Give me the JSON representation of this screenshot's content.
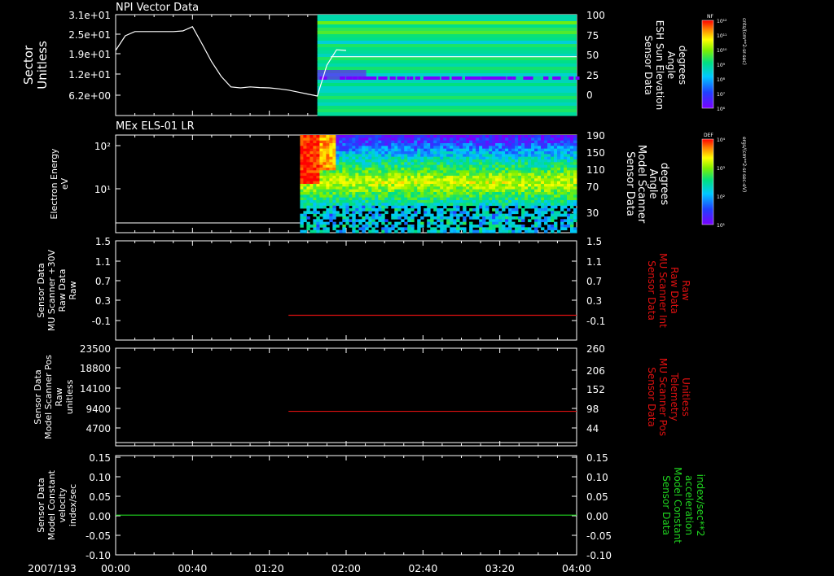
{
  "date_label": "2007/193",
  "time_ticks": [
    "00:00",
    "00:40",
    "01:20",
    "02:00",
    "02:40",
    "03:20",
    "04:00"
  ],
  "colors": {
    "white": "#ffffff",
    "red": "#e01010",
    "green": "#1fd41f",
    "background": "#000000"
  },
  "colorbars": [
    {
      "title": "NF",
      "unit": "cnts/(cm**2-sr-sec)",
      "ticks": [
        "10¹²",
        "10¹¹",
        "10¹⁰",
        "10⁹",
        "10⁸",
        "10⁷",
        "10⁶"
      ]
    },
    {
      "title": "DEF",
      "unit": "ergs/(cm**2-sr-sec-eV)",
      "ticks": [
        "10⁴",
        "10³",
        "10²",
        "10¹"
      ]
    }
  ],
  "chart_data": [
    {
      "type": "line",
      "title": "NPI Vector Data",
      "ylabel": [
        "Sector",
        "Unitless"
      ],
      "y_ticks": [
        "3.1e+01",
        "2.5e+01",
        "1.9e+01",
        "1.2e+01",
        "6.2e+00"
      ],
      "ylim": [
        0,
        31
      ],
      "right_ylabel": [
        "Sensor Data",
        "ESH Sun Elevation",
        "Angle",
        "degrees"
      ],
      "right_ticks": [
        "100",
        "75",
        "50",
        "25",
        "0"
      ],
      "right_ylim": [
        -20,
        100
      ],
      "spectrogram_start": "01:45",
      "horizontal_line_value": 50,
      "series": [
        {
          "x": [
            "00:00",
            "00:05",
            "00:10",
            "00:15",
            "00:20",
            "00:25",
            "00:30",
            "00:35",
            "00:40",
            "00:45",
            "00:50",
            "00:55",
            "01:00",
            "01:05",
            "01:10",
            "01:15",
            "01:20",
            "01:25",
            "01:30",
            "01:35",
            "01:40",
            "01:45",
            "01:50",
            "01:55",
            "02:00"
          ],
          "values": [
            20,
            24.5,
            25.8,
            25.8,
            25.8,
            25.8,
            25.8,
            26,
            27.3,
            22,
            16.5,
            12,
            8.8,
            8.5,
            8.8,
            8.6,
            8.5,
            8.2,
            7.8,
            7.2,
            6.6,
            6,
            15.5,
            20.2,
            20
          ]
        }
      ]
    },
    {
      "type": "heatmap",
      "title": "MEx ELS-01 LR",
      "ylabel": [
        "Electron Energy",
        "eV"
      ],
      "y_ticks": [
        "10²",
        "10¹"
      ],
      "yscale": "log",
      "right_ylabel": [
        "Sensor Data",
        "Model Scanner",
        "Angle",
        "degrees"
      ],
      "right_ticks": [
        "190",
        "150",
        "110",
        "70",
        "30"
      ],
      "spectrogram_start": "01:36",
      "white_line_value": "01:36"
    },
    {
      "type": "line",
      "ylabel": [
        "Sensor Data",
        "MU Scanner +30V",
        "Raw Data",
        "Raw"
      ],
      "y_ticks": [
        "1.5",
        "1.1",
        "0.7",
        "0.3",
        "-0.1"
      ],
      "ylim": [
        -0.5,
        1.5
      ],
      "right_ylabel": [
        "Sensor Data",
        "MU Scanner Int",
        "Raw Data",
        "Raw"
      ],
      "right_ticks": [
        "1.5",
        "1.1",
        "0.7",
        "0.3",
        "-0.1"
      ],
      "series": [
        {
          "color": "red",
          "x": [
            "01:30",
            "04:00"
          ],
          "values": [
            0.0,
            0.0
          ]
        }
      ]
    },
    {
      "type": "line",
      "ylabel": [
        "Sensor Data",
        "Model Scanner Pos",
        "Raw",
        "unitless"
      ],
      "y_ticks": [
        "23500",
        "18800",
        "14100",
        "9400",
        "4700"
      ],
      "ylim": [
        0,
        23500
      ],
      "right_ylabel": [
        "Sensor Data",
        "MU Scanner Pos",
        "Telemetry",
        "Unitless"
      ],
      "right_ticks": [
        "260",
        "206",
        "152",
        "98",
        "44"
      ],
      "series": [
        {
          "color": "red",
          "x": [
            "01:30",
            "04:00"
          ],
          "right_values": [
            90,
            90
          ]
        }
      ]
    },
    {
      "type": "line",
      "ylabel": [
        "Sensor Data",
        "Model Constant",
        "velocity",
        "index/sec"
      ],
      "y_ticks": [
        "0.15",
        "0.10",
        "0.05",
        "0.00",
        "-0.05",
        "-0.10"
      ],
      "ylim": [
        -0.1,
        0.15
      ],
      "right_ylabel": [
        "Sensor Data",
        "Model Constant",
        "acceleration",
        "index/sec**2"
      ],
      "right_ticks": [
        "0.15",
        "0.10",
        "0.05",
        "0.00",
        "-0.05",
        "-0.10"
      ],
      "series": [
        {
          "color": "green",
          "x": [
            "00:00",
            "04:00"
          ],
          "values": [
            0.0,
            0.0
          ]
        }
      ]
    }
  ]
}
